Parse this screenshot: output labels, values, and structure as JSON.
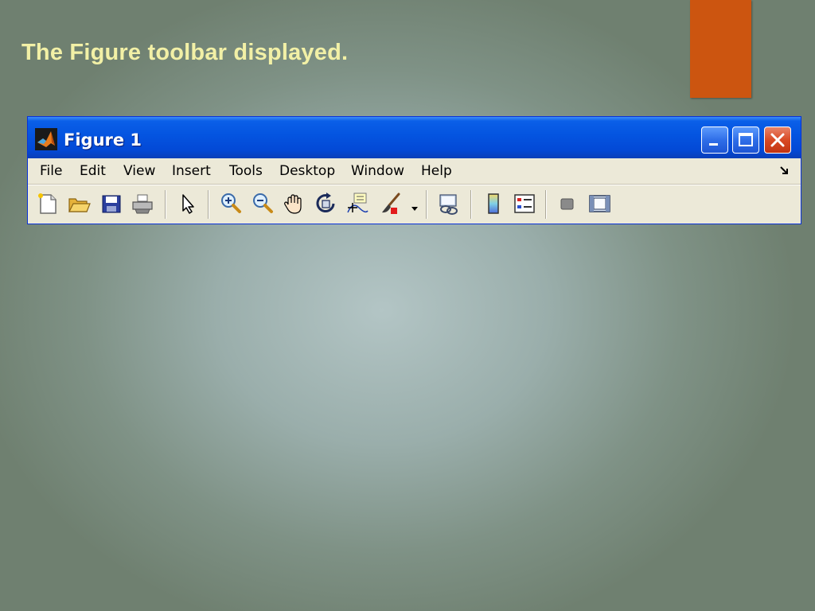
{
  "slide": {
    "title": "The Figure toolbar displayed."
  },
  "colors": {
    "title_text": "#f2f0a6",
    "accent": "#cc5510",
    "titlebar": "#0454e0",
    "window_bg": "#ece9d8"
  },
  "window": {
    "title": "Figure 1",
    "app_icon": "matlab-logo-icon",
    "controls": [
      "minimize-icon",
      "maximize-icon",
      "close-icon"
    ]
  },
  "menubar": {
    "items": [
      "File",
      "Edit",
      "View",
      "Insert",
      "Tools",
      "Desktop",
      "Window",
      "Help"
    ],
    "dock_icon": "dock-arrow-icon"
  },
  "toolbar": {
    "buttons": [
      {
        "icon": "new-figure-icon"
      },
      {
        "icon": "open-file-icon"
      },
      {
        "icon": "save-figure-icon"
      },
      {
        "icon": "print-figure-icon"
      },
      {
        "icon": "edit-plot-arrow-icon"
      },
      {
        "icon": "zoom-in-icon"
      },
      {
        "icon": "zoom-out-icon"
      },
      {
        "icon": "pan-hand-icon"
      },
      {
        "icon": "rotate-3d-icon"
      },
      {
        "icon": "data-cursor-icon"
      },
      {
        "icon": "brush-icon"
      },
      {
        "icon": "link-plot-icon"
      },
      {
        "icon": "insert-colorbar-icon"
      },
      {
        "icon": "insert-legend-icon"
      },
      {
        "icon": "hide-plot-tools-icon"
      },
      {
        "icon": "show-plot-tools-icon"
      }
    ]
  }
}
